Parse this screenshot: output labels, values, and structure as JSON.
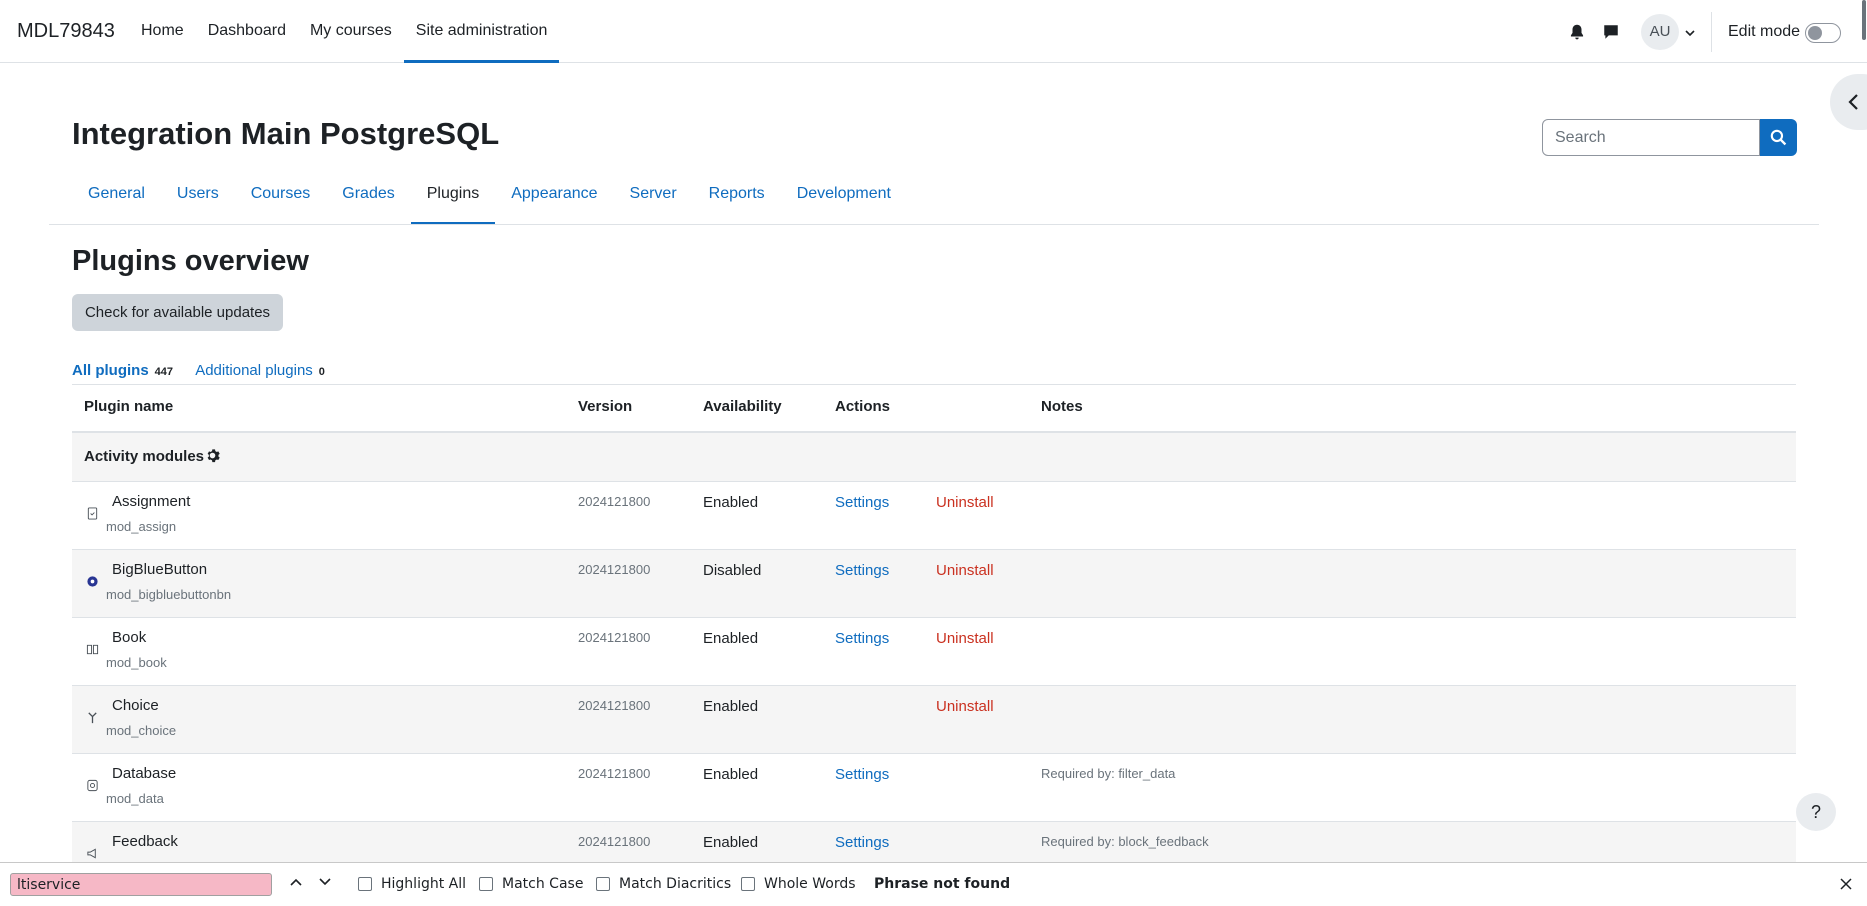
{
  "navbar": {
    "brand": "MDL79843",
    "items": [
      {
        "label": "Home"
      },
      {
        "label": "Dashboard"
      },
      {
        "label": "My courses"
      },
      {
        "label": "Site administration"
      }
    ],
    "active_item": "Site administration",
    "avatar_initials": "AU",
    "edit_mode_label": "Edit mode",
    "edit_mode_on": false
  },
  "header": {
    "title": "Integration Main PostgreSQL",
    "search_placeholder": "Search"
  },
  "secondary_nav": {
    "tabs": [
      {
        "label": "General"
      },
      {
        "label": "Users"
      },
      {
        "label": "Courses"
      },
      {
        "label": "Grades"
      },
      {
        "label": "Plugins"
      },
      {
        "label": "Appearance"
      },
      {
        "label": "Server"
      },
      {
        "label": "Reports"
      },
      {
        "label": "Development"
      }
    ],
    "active_tab": "Plugins"
  },
  "main": {
    "heading": "Plugins overview",
    "check_updates_label": "Check for available updates",
    "filters": [
      {
        "label": "All plugins",
        "count": "447"
      },
      {
        "label": "Additional plugins",
        "count": "0"
      }
    ],
    "table": {
      "headers": [
        "Plugin name",
        "Version",
        "Availability",
        "Actions",
        "Notes"
      ],
      "group": "Activity modules",
      "rows": [
        {
          "name": "Assignment",
          "component": "mod_assign",
          "version": "2024121800",
          "availability": "Enabled",
          "settings": "Settings",
          "uninstall": "Uninstall",
          "notes": ""
        },
        {
          "name": "BigBlueButton",
          "component": "mod_bigbluebuttonbn",
          "version": "2024121800",
          "availability": "Disabled",
          "settings": "Settings",
          "uninstall": "Uninstall",
          "notes": ""
        },
        {
          "name": "Book",
          "component": "mod_book",
          "version": "2024121800",
          "availability": "Enabled",
          "settings": "Settings",
          "uninstall": "Uninstall",
          "notes": ""
        },
        {
          "name": "Choice",
          "component": "mod_choice",
          "version": "2024121800",
          "availability": "Enabled",
          "settings": "",
          "uninstall": "Uninstall",
          "notes": ""
        },
        {
          "name": "Database",
          "component": "mod_data",
          "version": "2024121800",
          "availability": "Enabled",
          "settings": "Settings",
          "uninstall": "",
          "notes": "Required by: filter_data"
        },
        {
          "name": "Feedback",
          "component": "",
          "version": "2024121800",
          "availability": "Enabled",
          "settings": "Settings",
          "uninstall": "",
          "notes": "Required by: block_feedback"
        }
      ]
    },
    "help_label": "?"
  },
  "findbar": {
    "query": "ltiservice",
    "options": [
      {
        "label": "Highlight All"
      },
      {
        "label": "Match Case"
      },
      {
        "label": "Match Diacritics"
      },
      {
        "label": "Whole Words"
      }
    ],
    "status": "Phrase not found"
  },
  "colors": {
    "primary": "#0f6cbf",
    "danger": "#ca3120",
    "find_not_found_bg": "#f6b8c6"
  }
}
